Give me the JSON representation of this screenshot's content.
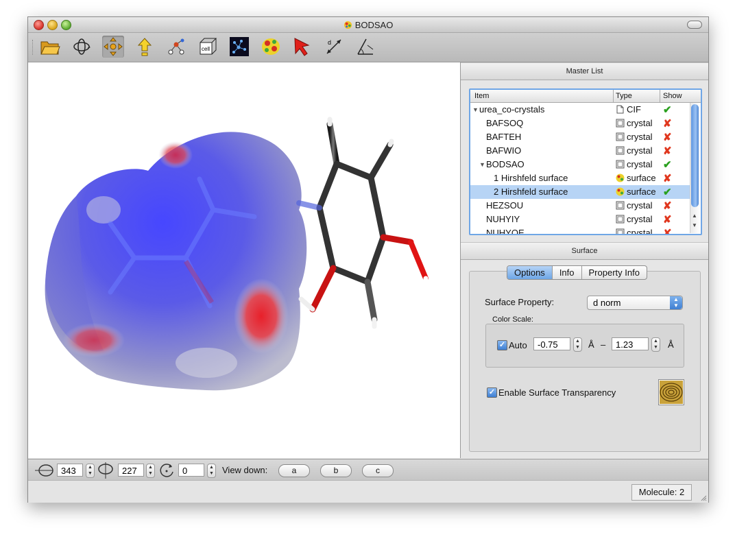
{
  "window": {
    "title": "BODSAO"
  },
  "toolbar": {
    "tools": [
      "open-file-icon",
      "rotate-icon",
      "translate-icon",
      "bonds-icon",
      "atoms-connect-icon",
      "unit-cell-icon",
      "crystal-field-icon",
      "hirshfeld-surface-icon",
      "select-arrow-icon",
      "distance-icon",
      "angle-icon"
    ]
  },
  "master_list": {
    "header": "Master List",
    "columns": {
      "item": "Item",
      "type": "Type",
      "show": "Show"
    },
    "rows": [
      {
        "name": "urea_co-crystals",
        "type": "CIF",
        "show": "✔"
      },
      {
        "name": "BAFSOQ",
        "type": "crystal",
        "show": "✘"
      },
      {
        "name": "BAFTEH",
        "type": "crystal",
        "show": "✘"
      },
      {
        "name": "BAFWIO",
        "type": "crystal",
        "show": "✘"
      },
      {
        "name": "BODSAO",
        "type": "crystal",
        "show": "✔"
      },
      {
        "name": "1 Hirshfeld surface",
        "type": "surface",
        "show": "✘"
      },
      {
        "name": "2 Hirshfeld surface",
        "type": "surface",
        "show": "✔"
      },
      {
        "name": "HEZSOU",
        "type": "crystal",
        "show": "✘"
      },
      {
        "name": "NUHYIY",
        "type": "crystal",
        "show": "✘"
      },
      {
        "name": "NUHYOE",
        "type": "crystal",
        "show": "✘"
      }
    ]
  },
  "surface_panel": {
    "header": "Surface",
    "tabs": [
      "Options",
      "Info",
      "Property Info"
    ],
    "property_label": "Surface Property:",
    "property_value": "d norm",
    "color_scale_label": "Color Scale:",
    "auto_label": "Auto",
    "min_value": "-0.75",
    "max_value": "1.23",
    "unit": "Å",
    "dash": "–",
    "transparency_label": "Enable Surface Transparency"
  },
  "bottom": {
    "rot_x": "343",
    "rot_y": "227",
    "rot_z": "0",
    "view_down_label": "View down:",
    "view_buttons": [
      "a",
      "b",
      "c"
    ]
  },
  "status": {
    "molecule": "Molecule: 2"
  }
}
